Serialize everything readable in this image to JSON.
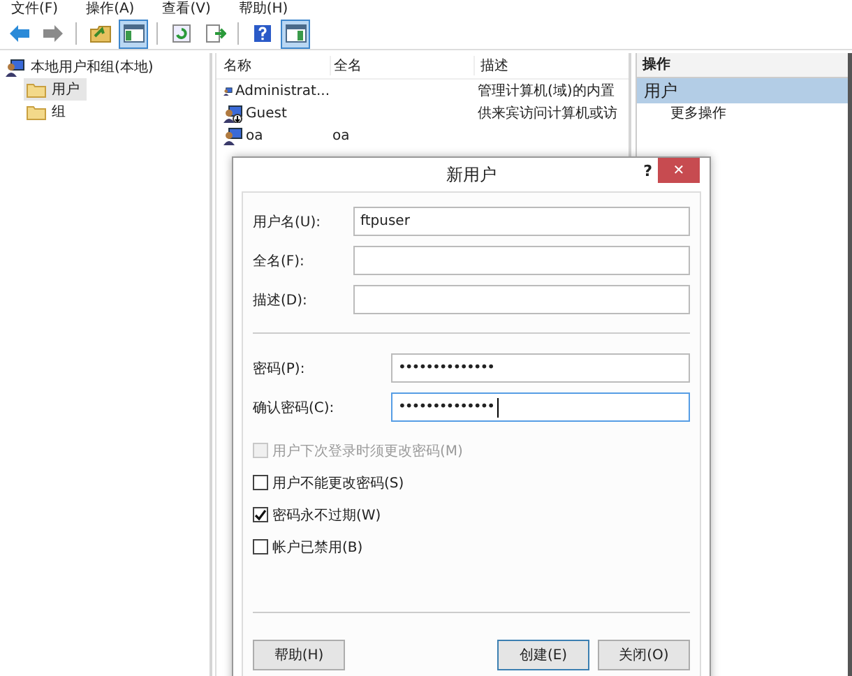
{
  "menu": [
    "文件(F)",
    "操作(A)",
    "查看(V)",
    "帮助(H)"
  ],
  "toolbar": [
    {
      "buttons": [
        {
          "kind": "back",
          "pressed": false
        },
        {
          "kind": "forward",
          "pressed": false
        }
      ]
    },
    {
      "buttons": [
        {
          "kind": "up",
          "pressed": false
        },
        {
          "kind": "tree",
          "pressed": true
        }
      ]
    },
    {
      "buttons": [
        {
          "kind": "refresh",
          "pressed": false
        },
        {
          "kind": "export",
          "pressed": false
        }
      ]
    },
    {
      "buttons": [
        {
          "kind": "help",
          "pressed": false
        },
        {
          "kind": "pane",
          "pressed": true
        }
      ]
    }
  ],
  "tree": {
    "label": "本地用户和组(本地)",
    "children": [
      {
        "label": "用户",
        "selected": true
      },
      {
        "label": "组",
        "selected": false
      }
    ]
  },
  "list": {
    "columns": [
      "名称",
      "全名",
      "描述"
    ],
    "rows": [
      {
        "name": "Administrat...",
        "description": "管理计算机(域)的内置",
        "disabled": false
      },
      {
        "name": "Guest",
        "description": "供来宾访问计算机或访",
        "disabled": true
      },
      {
        "name": "oa",
        "full_name": "oa",
        "disabled": false
      }
    ]
  },
  "actions": {
    "header": "操作",
    "section": "用户",
    "items": [
      "更多操作"
    ]
  },
  "dialog": {
    "title": "新用户",
    "help": "?",
    "close": "✕",
    "account_fields": [
      {
        "label": "用户名(U):",
        "value": "ftpuser",
        "focused": false
      },
      {
        "label": "全名(F):",
        "focused": false
      },
      {
        "label": "描述(D):",
        "focused": false
      }
    ],
    "password_fields": [
      {
        "label": "密码(P):",
        "value": "••••••••••••••",
        "focused": false
      },
      {
        "label": "确认密码(C):",
        "value": "••••••••••••••",
        "focused": true
      }
    ],
    "checkboxes": [
      {
        "label": "用户下次登录时须更改密码(M)",
        "checked": false,
        "disabled": true
      },
      {
        "label": "用户不能更改密码(S)",
        "checked": false,
        "disabled": false
      },
      {
        "label": "密码永不过期(W)",
        "checked": true,
        "disabled": false
      },
      {
        "label": "帐户已禁用(B)",
        "checked": false,
        "disabled": false
      }
    ],
    "buttons": [
      {
        "label": "帮助(H)",
        "default": false
      },
      {
        "label": "创建(E)",
        "default": true
      },
      {
        "label": "关闭(O)",
        "default": false
      }
    ]
  }
}
